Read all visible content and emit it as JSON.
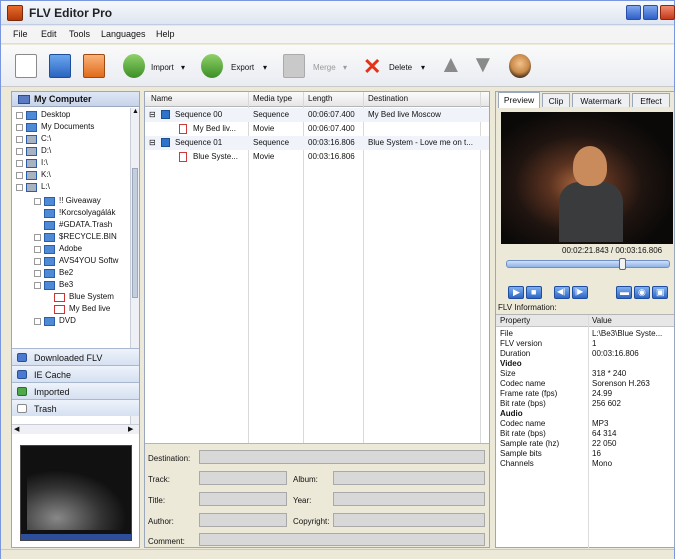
{
  "window": {
    "title": "FLV Editor Pro"
  },
  "menu": [
    "File",
    "Edit",
    "Tools",
    "Languages",
    "Help"
  ],
  "toolbar": {
    "import_label": "Import",
    "export_label": "Export",
    "merge_label": "Merge",
    "delete_label": "Delete"
  },
  "sidebar": {
    "header": "My Computer",
    "tree": [
      {
        "label": "Desktop"
      },
      {
        "label": "My Documents"
      },
      {
        "label": "C:\\"
      },
      {
        "label": "D:\\"
      },
      {
        "label": "I:\\"
      },
      {
        "label": "K:\\"
      },
      {
        "label": "L:\\"
      },
      {
        "label": "!! Giveaway"
      },
      {
        "label": "!Korcsolyagálák"
      },
      {
        "label": "#GDATA.Trash"
      },
      {
        "label": "$RECYCLE.BIN"
      },
      {
        "label": "Adobe"
      },
      {
        "label": "AVS4YOU Softw"
      },
      {
        "label": "Be2"
      },
      {
        "label": "Be3"
      },
      {
        "label": "Blue System"
      },
      {
        "label": "My Bed live"
      },
      {
        "label": "DVD"
      }
    ],
    "sections": [
      "Downloaded FLV",
      "IE Cache",
      "Imported",
      "Trash"
    ]
  },
  "grid": {
    "columns": [
      "Name",
      "Media type",
      "Length",
      "Destination"
    ],
    "rows": [
      {
        "name": "Sequence 00",
        "type": "Sequence",
        "length": "00:06:07.400",
        "dest": "My Bed live Moscow"
      },
      {
        "name": "My Bed liv...",
        "type": "Movie",
        "length": "00:06:07.400",
        "dest": ""
      },
      {
        "name": "Sequence 01",
        "type": "Sequence",
        "length": "00:03:16.806",
        "dest": "Blue System - Love me on t..."
      },
      {
        "name": "Blue Syste...",
        "type": "Movie",
        "length": "00:03:16.806",
        "dest": ""
      }
    ]
  },
  "form": {
    "destination": "Destination:",
    "track": "Track:",
    "album": "Album:",
    "title": "Title:",
    "year": "Year:",
    "author": "Author:",
    "copyright": "Copyright:",
    "comment": "Comment:"
  },
  "preview": {
    "tabs": [
      "Preview",
      "Clip",
      "Watermark",
      "Effect"
    ],
    "timecode": "00:02:21.843 / 00:03:16.806",
    "seek_position": 0.72,
    "info_label": "FLV Information:",
    "prop_header": "Property",
    "value_header": "Value",
    "props": [
      {
        "k": "File",
        "v": "L:\\Be3\\Blue Syste..."
      },
      {
        "k": "FLV version",
        "v": "1"
      },
      {
        "k": "Duration",
        "v": "00:03:16.806"
      },
      {
        "k": "Video",
        "v": "",
        "group": true
      },
      {
        "k": "Size",
        "v": "318 * 240"
      },
      {
        "k": "Codec name",
        "v": "Sorenson H.263"
      },
      {
        "k": "Frame rate (fps)",
        "v": "24.99"
      },
      {
        "k": "Bit rate (bps)",
        "v": "256 602"
      },
      {
        "k": "Audio",
        "v": "",
        "group": true
      },
      {
        "k": "Codec name",
        "v": "MP3"
      },
      {
        "k": "Bit rate (bps)",
        "v": "64 314"
      },
      {
        "k": "Sample rate (hz)",
        "v": "22 050"
      },
      {
        "k": "Sample bits",
        "v": "16"
      },
      {
        "k": "Channels",
        "v": "Mono"
      }
    ]
  }
}
